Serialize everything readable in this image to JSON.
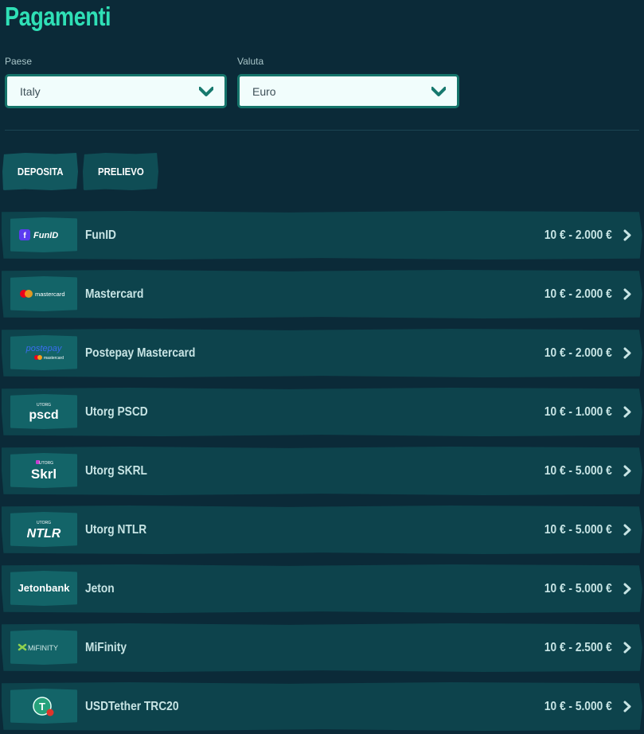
{
  "page": {
    "title": "Pagamenti"
  },
  "filters": {
    "country": {
      "label": "Paese",
      "value": "Italy"
    },
    "currency": {
      "label": "Valuta",
      "value": "Euro"
    }
  },
  "tabs": [
    {
      "label": "DEPOSITA",
      "active": true
    },
    {
      "label": "PRELIEVO",
      "active": false
    }
  ],
  "methods": [
    {
      "name": "FunID",
      "range": "10 € - 2.000 €",
      "logo": "funid-logo",
      "logo_text": "FunID"
    },
    {
      "name": "Mastercard",
      "range": "10 € - 2.000 €",
      "logo": "mastercard-logo",
      "logo_text": "mastercard"
    },
    {
      "name": "Postepay Mastercard",
      "range": "10 € - 2.000 €",
      "logo": "postepay-logo",
      "logo_text": "postepay",
      "logo_sub": "mastercard"
    },
    {
      "name": "Utorg PSCD",
      "range": "10 € - 1.000 €",
      "logo": "utorg-pscd-logo",
      "logo_top": "UTORG",
      "logo_text": "pscd"
    },
    {
      "name": "Utorg SKRL",
      "range": "10 € - 5.000 €",
      "logo": "utorg-skrl-logo",
      "logo_top": "UTORG",
      "logo_text": "Skrl"
    },
    {
      "name": "Utorg NTLR",
      "range": "10 € - 5.000 €",
      "logo": "utorg-ntlr-logo",
      "logo_top": "UTORG",
      "logo_text": "NTLR"
    },
    {
      "name": "Jeton",
      "range": "10 € - 5.000 €",
      "logo": "jetonbank-logo",
      "logo_text": "Jetonbank"
    },
    {
      "name": "MiFinity",
      "range": "10 € - 2.500 €",
      "logo": "mifinity-logo",
      "logo_text": "MiFINITY"
    },
    {
      "name": "USDTether TRC20",
      "range": "10 € - 5.000 €",
      "logo": "tether-logo",
      "logo_text": "T"
    }
  ],
  "colors": {
    "background": "#0b2a38",
    "title": "#2fe0b6",
    "row": "#0d434c",
    "logo_box": "#136468",
    "accent": "#15746a"
  }
}
